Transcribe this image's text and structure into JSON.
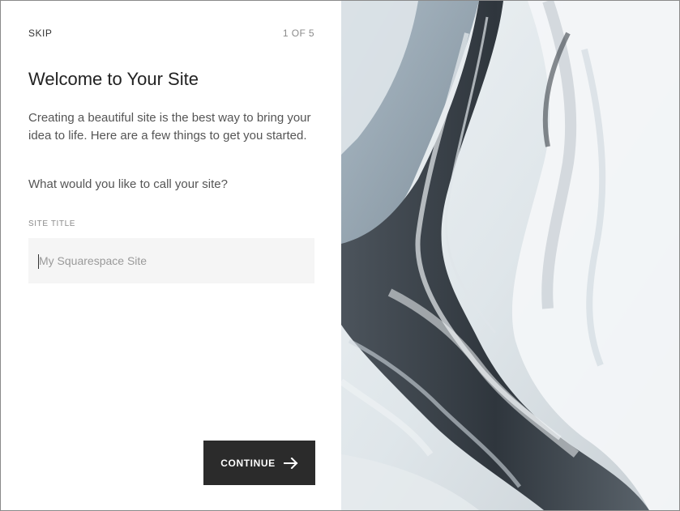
{
  "onboarding": {
    "skip_label": "SKIP",
    "step_indicator": "1 OF 5",
    "title": "Welcome to Your Site",
    "intro": "Creating a beautiful site is the best way to bring your idea to life. Here are a few things to get you started.",
    "question": "What would you like to call your site?",
    "site_title_label": "SITE TITLE",
    "site_title_placeholder": "My Squarespace Site",
    "site_title_value": "",
    "continue_label": "CONTINUE",
    "continue_icon": "arrow-right-icon"
  },
  "colors": {
    "button_bg": "#2b2b2b",
    "input_bg": "#f5f5f5",
    "muted_text": "#8a8a8a"
  },
  "image": {
    "subject": "marble-texture-image"
  }
}
